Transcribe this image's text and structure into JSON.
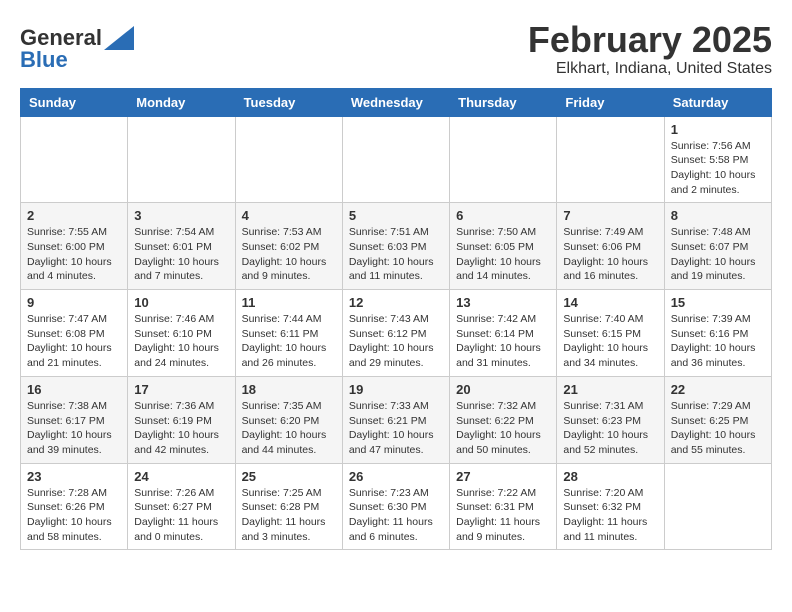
{
  "logo": {
    "general": "General",
    "blue": "Blue"
  },
  "title": "February 2025",
  "subtitle": "Elkhart, Indiana, United States",
  "weekdays": [
    "Sunday",
    "Monday",
    "Tuesday",
    "Wednesday",
    "Thursday",
    "Friday",
    "Saturday"
  ],
  "weeks": [
    [
      {
        "num": "",
        "info": ""
      },
      {
        "num": "",
        "info": ""
      },
      {
        "num": "",
        "info": ""
      },
      {
        "num": "",
        "info": ""
      },
      {
        "num": "",
        "info": ""
      },
      {
        "num": "",
        "info": ""
      },
      {
        "num": "1",
        "info": "Sunrise: 7:56 AM\nSunset: 5:58 PM\nDaylight: 10 hours and 2 minutes."
      }
    ],
    [
      {
        "num": "2",
        "info": "Sunrise: 7:55 AM\nSunset: 6:00 PM\nDaylight: 10 hours and 4 minutes."
      },
      {
        "num": "3",
        "info": "Sunrise: 7:54 AM\nSunset: 6:01 PM\nDaylight: 10 hours and 7 minutes."
      },
      {
        "num": "4",
        "info": "Sunrise: 7:53 AM\nSunset: 6:02 PM\nDaylight: 10 hours and 9 minutes."
      },
      {
        "num": "5",
        "info": "Sunrise: 7:51 AM\nSunset: 6:03 PM\nDaylight: 10 hours and 11 minutes."
      },
      {
        "num": "6",
        "info": "Sunrise: 7:50 AM\nSunset: 6:05 PM\nDaylight: 10 hours and 14 minutes."
      },
      {
        "num": "7",
        "info": "Sunrise: 7:49 AM\nSunset: 6:06 PM\nDaylight: 10 hours and 16 minutes."
      },
      {
        "num": "8",
        "info": "Sunrise: 7:48 AM\nSunset: 6:07 PM\nDaylight: 10 hours and 19 minutes."
      }
    ],
    [
      {
        "num": "9",
        "info": "Sunrise: 7:47 AM\nSunset: 6:08 PM\nDaylight: 10 hours and 21 minutes."
      },
      {
        "num": "10",
        "info": "Sunrise: 7:46 AM\nSunset: 6:10 PM\nDaylight: 10 hours and 24 minutes."
      },
      {
        "num": "11",
        "info": "Sunrise: 7:44 AM\nSunset: 6:11 PM\nDaylight: 10 hours and 26 minutes."
      },
      {
        "num": "12",
        "info": "Sunrise: 7:43 AM\nSunset: 6:12 PM\nDaylight: 10 hours and 29 minutes."
      },
      {
        "num": "13",
        "info": "Sunrise: 7:42 AM\nSunset: 6:14 PM\nDaylight: 10 hours and 31 minutes."
      },
      {
        "num": "14",
        "info": "Sunrise: 7:40 AM\nSunset: 6:15 PM\nDaylight: 10 hours and 34 minutes."
      },
      {
        "num": "15",
        "info": "Sunrise: 7:39 AM\nSunset: 6:16 PM\nDaylight: 10 hours and 36 minutes."
      }
    ],
    [
      {
        "num": "16",
        "info": "Sunrise: 7:38 AM\nSunset: 6:17 PM\nDaylight: 10 hours and 39 minutes."
      },
      {
        "num": "17",
        "info": "Sunrise: 7:36 AM\nSunset: 6:19 PM\nDaylight: 10 hours and 42 minutes."
      },
      {
        "num": "18",
        "info": "Sunrise: 7:35 AM\nSunset: 6:20 PM\nDaylight: 10 hours and 44 minutes."
      },
      {
        "num": "19",
        "info": "Sunrise: 7:33 AM\nSunset: 6:21 PM\nDaylight: 10 hours and 47 minutes."
      },
      {
        "num": "20",
        "info": "Sunrise: 7:32 AM\nSunset: 6:22 PM\nDaylight: 10 hours and 50 minutes."
      },
      {
        "num": "21",
        "info": "Sunrise: 7:31 AM\nSunset: 6:23 PM\nDaylight: 10 hours and 52 minutes."
      },
      {
        "num": "22",
        "info": "Sunrise: 7:29 AM\nSunset: 6:25 PM\nDaylight: 10 hours and 55 minutes."
      }
    ],
    [
      {
        "num": "23",
        "info": "Sunrise: 7:28 AM\nSunset: 6:26 PM\nDaylight: 10 hours and 58 minutes."
      },
      {
        "num": "24",
        "info": "Sunrise: 7:26 AM\nSunset: 6:27 PM\nDaylight: 11 hours and 0 minutes."
      },
      {
        "num": "25",
        "info": "Sunrise: 7:25 AM\nSunset: 6:28 PM\nDaylight: 11 hours and 3 minutes."
      },
      {
        "num": "26",
        "info": "Sunrise: 7:23 AM\nSunset: 6:30 PM\nDaylight: 11 hours and 6 minutes."
      },
      {
        "num": "27",
        "info": "Sunrise: 7:22 AM\nSunset: 6:31 PM\nDaylight: 11 hours and 9 minutes."
      },
      {
        "num": "28",
        "info": "Sunrise: 7:20 AM\nSunset: 6:32 PM\nDaylight: 11 hours and 11 minutes."
      },
      {
        "num": "",
        "info": ""
      }
    ]
  ]
}
